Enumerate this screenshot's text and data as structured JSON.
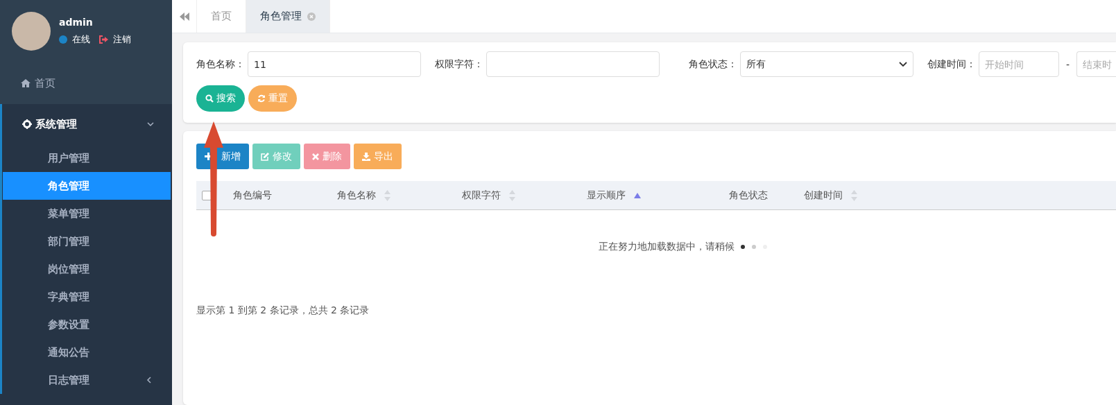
{
  "sidebar": {
    "user": {
      "name": "admin",
      "status": "在线",
      "logout": "注销"
    },
    "menu": [
      {
        "label": "首页"
      },
      {
        "label": "系统管理",
        "expanded": true,
        "children": [
          {
            "label": "用户管理",
            "selected": false
          },
          {
            "label": "角色管理",
            "selected": true
          },
          {
            "label": "菜单管理",
            "selected": false
          },
          {
            "label": "部门管理",
            "selected": false
          },
          {
            "label": "岗位管理",
            "selected": false
          },
          {
            "label": "字典管理",
            "selected": false
          },
          {
            "label": "参数设置",
            "selected": false
          },
          {
            "label": "通知公告",
            "selected": false
          },
          {
            "label": "日志管理",
            "expanded": false,
            "selected": false
          }
        ]
      }
    ]
  },
  "tabs": [
    {
      "label": "首页",
      "selected": false,
      "closable": false
    },
    {
      "label": "角色管理",
      "selected": true,
      "closable": true
    }
  ],
  "search": {
    "fields": [
      {
        "label": "角色名称：",
        "kind": "text",
        "value": "11"
      },
      {
        "label": "权限字符：",
        "kind": "text"
      },
      {
        "label": "角色状态：",
        "kind": "select",
        "value": "所有"
      },
      {
        "label": "创建时间：",
        "kind": "range",
        "placeholder": "开始时间",
        "separator": "-",
        "placeholder_end": "结束时"
      }
    ],
    "buttons": [
      {
        "label": "搜索",
        "kind": "search"
      },
      {
        "label": "重置",
        "kind": "reset"
      }
    ]
  },
  "toolbar": [
    {
      "label": "新增",
      "kind": "add",
      "disabled": false
    },
    {
      "label": "修改",
      "kind": "edit",
      "disabled": true
    },
    {
      "label": "删除",
      "kind": "delete",
      "disabled": true
    },
    {
      "label": "导出",
      "kind": "export",
      "disabled": false
    }
  ],
  "table": {
    "select_all": {
      "checked": false
    },
    "columns": [
      {
        "label": "角色编号",
        "kind": "plain"
      },
      {
        "label": "角色名称",
        "kind": "sortable"
      },
      {
        "label": "权限字符",
        "kind": "sortable"
      },
      {
        "label": "显示顺序",
        "kind": "sorted_asc"
      },
      {
        "label": "角色状态",
        "kind": "plain"
      },
      {
        "label": "创建时间",
        "kind": "sortable"
      }
    ],
    "loading": "正在努力地加载数据中，请稍候",
    "footer": "显示第 1 到第 2 条记录，总共 2 条记录"
  }
}
